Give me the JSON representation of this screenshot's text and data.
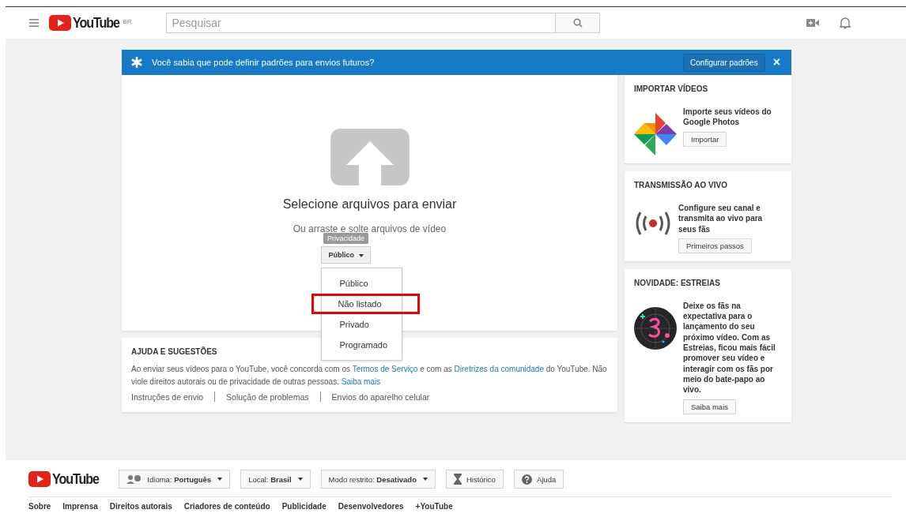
{
  "header": {
    "logo": "YouTube",
    "region": "BR",
    "search": {
      "placeholder": "Pesquisar"
    }
  },
  "banner": {
    "text": "Você sabia que pode definir padrões para envios futuros?",
    "button": "Configurar padrões",
    "close": "×"
  },
  "upload": {
    "title": "Selecione arquivos para enviar",
    "subtitle": "Ou arraste e solte arquivos de vídeo",
    "tooltip": "Privacidade",
    "privacy_button": "Público",
    "menu": [
      {
        "label": "Público",
        "highlighted": false
      },
      {
        "label": "Não listado",
        "highlighted": true
      },
      {
        "label": "Privado",
        "highlighted": false
      },
      {
        "label": "Programado",
        "highlighted": false
      }
    ]
  },
  "help": {
    "title": "AJUDA E SUGESTÕES",
    "text_before": "Ao enviar seus vídeos para o YouTube, você concorda com os",
    "link_terms": "Termos de Serviço",
    "text_middle": "e com as",
    "link_guidelines": "Diretrizes da comunidade",
    "text_after": "do YouTube. Não viole direitos autorais ou de privacidade de outras pessoas.",
    "link_more": "Saiba mais",
    "links": [
      "Instruções de envio",
      "Solução de problemas",
      "Envios do aparelho celular"
    ]
  },
  "sidebar": [
    {
      "kind": "photos",
      "title": "IMPORTAR VÍDEOS",
      "text": "Importe seus vídeos do Google Photos",
      "button": "Importar"
    },
    {
      "kind": "live",
      "title": "TRANSMISSÃO AO VIVO",
      "text": "Configure seu canal e transmita ao vivo para seus fãs",
      "button": "Primeiros passos"
    },
    {
      "kind": "premiere",
      "title": "NOVIDADE: ESTREIAS",
      "text": "Deixe os fãs na expectativa para o lançamento do seu próximo vídeo. Com as Estreias, ficou mais fácil promover seu vídeo e interagir com os fãs por meio do bate-papo ao vivo.",
      "button": "Saiba mais"
    }
  ],
  "footer": {
    "logo": "YouTube",
    "buttons": [
      {
        "kind": "language",
        "label": "Idioma: **Português**"
      },
      {
        "kind": "menu",
        "label": "Local: **Brasil**"
      },
      {
        "kind": "menu",
        "label": "Modo restrito: **Desativado**"
      },
      {
        "kind": "history",
        "label": "Histórico"
      },
      {
        "kind": "help",
        "label": "Ajuda"
      }
    ],
    "links": [
      "Sobre",
      "Imprensa",
      "Direitos autorais",
      "Criadores de conteúdo",
      "Publicidade",
      "Desenvolvedores",
      "+YouTube"
    ]
  }
}
